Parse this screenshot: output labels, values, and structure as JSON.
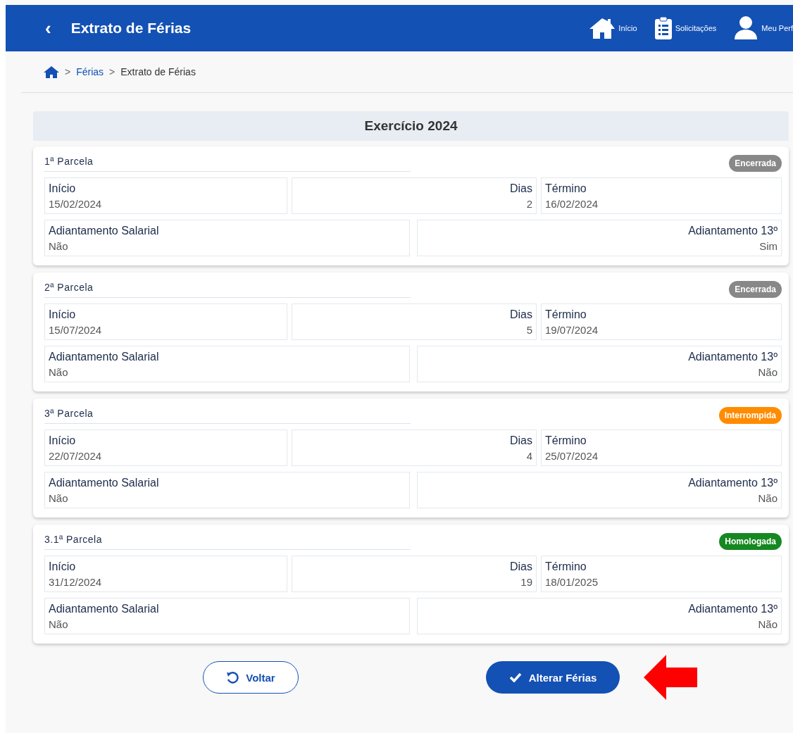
{
  "header": {
    "back": "‹",
    "title": "Extrato de Férias",
    "nav": [
      {
        "kind": "home",
        "label": "Início"
      },
      {
        "kind": "list",
        "label": "Solicitações"
      },
      {
        "kind": "user",
        "label": "Meu Perf"
      }
    ]
  },
  "breadcrumb": [
    {
      "separator": ">",
      "label": "Férias",
      "link": true
    },
    {
      "separator": ">",
      "label": "Extrato de Férias",
      "link": false
    }
  ],
  "section_title": "Exercício 2024",
  "parcelas": [
    {
      "title": "1ª Parcela",
      "status": {
        "label": "Encerrada",
        "color": "#888888"
      },
      "fields": [
        {
          "label": "Início",
          "value": "15/02/2024"
        },
        {
          "label": "Dias",
          "value": "2"
        },
        {
          "label": "Término",
          "value": "16/02/2024"
        },
        {
          "label": "Adiantamento Salarial",
          "value": "Não"
        },
        {
          "label": "Adiantamento 13º",
          "value": "Sim"
        }
      ]
    },
    {
      "title": "2ª Parcela",
      "status": {
        "label": "Encerrada",
        "color": "#888888"
      },
      "fields": [
        {
          "label": "Início",
          "value": "15/07/2024"
        },
        {
          "label": "Dias",
          "value": "5"
        },
        {
          "label": "Término",
          "value": "19/07/2024"
        },
        {
          "label": "Adiantamento Salarial",
          "value": "Não"
        },
        {
          "label": "Adiantamento 13º",
          "value": "Não"
        }
      ]
    },
    {
      "title": "3ª Parcela",
      "status": {
        "label": "Interrompida",
        "color": "#ff8c00"
      },
      "fields": [
        {
          "label": "Início",
          "value": "22/07/2024"
        },
        {
          "label": "Dias",
          "value": "4"
        },
        {
          "label": "Término",
          "value": "25/07/2024"
        },
        {
          "label": "Adiantamento Salarial",
          "value": "Não"
        },
        {
          "label": "Adiantamento 13º",
          "value": "Não"
        }
      ]
    },
    {
      "title": "3.1ª Parcela",
      "status": {
        "label": "Homologada",
        "color": "#168821"
      },
      "fields": [
        {
          "label": "Início",
          "value": "31/12/2024"
        },
        {
          "label": "Dias",
          "value": "19"
        },
        {
          "label": "Término",
          "value": "18/01/2025"
        },
        {
          "label": "Adiantamento Salarial",
          "value": "Não"
        },
        {
          "label": "Adiantamento 13º",
          "value": "Não"
        }
      ]
    }
  ],
  "buttons": [
    {
      "kind": "secondary",
      "label": "Voltar"
    },
    {
      "kind": "primary",
      "label": "Alterar Férias"
    }
  ]
}
